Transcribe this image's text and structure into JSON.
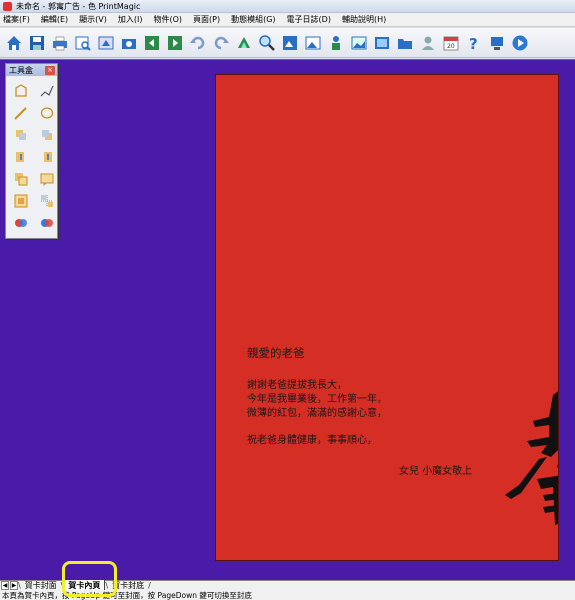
{
  "window": {
    "title": "未命名 - 郭寓广告 - 色 PrintMagic"
  },
  "menu": [
    "檔案(F)",
    "編輯(E)",
    "顯示(V)",
    "加入(I)",
    "物件(O)",
    "頁面(P)",
    "動態模組(G)",
    "電子日誌(D)",
    "輔助說明(H)"
  ],
  "toolbar_icons": [
    "home-icon",
    "save-icon",
    "print-icon",
    "print-preview-icon",
    "export-icon",
    "camera-icon",
    "prev-page-icon",
    "next-page-icon",
    "undo-icon",
    "redo-icon",
    "rotate-icon",
    "zoom-icon",
    "image-icon",
    "photo-icon",
    "person-icon",
    "picture-icon",
    "gallery-icon",
    "folder-icon",
    "user-icon",
    "calendar-icon",
    "help-icon",
    "network-icon",
    "play-icon"
  ],
  "toolbox": {
    "title": "工具盒",
    "close": "×"
  },
  "card": {
    "heading": "親愛的老爸",
    "lines": [
      "謝謝老爸提拔我長大，",
      "今年是我畢業後，工作第一年，",
      "微薄的紅包，滿滿的感謝心意，",
      "祝老爸身體健康，事事順心，"
    ],
    "signature": "女兒 小魔女敬上",
    "calligraphy": "春",
    "color": "#d42e25"
  },
  "tabs": {
    "items": [
      "賀卡封面",
      "賀卡內頁",
      "賀卡封底"
    ],
    "active": 1
  },
  "status": {
    "text": "本頁為賀卡內頁，按 PageUp 鍵可至封面，按 PageDown 鍵可切換至封底"
  },
  "colors": {
    "workspace": "#4a1ba8",
    "highlight": "#f2ef2a"
  }
}
